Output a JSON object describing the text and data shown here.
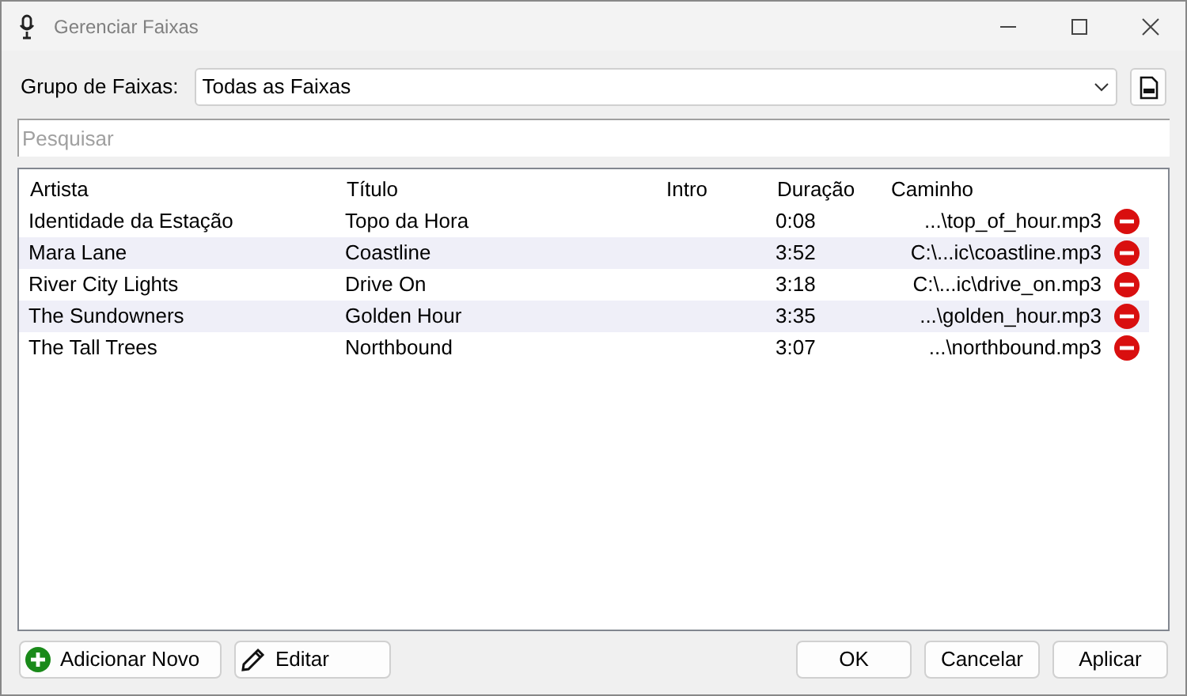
{
  "window": {
    "title": "Gerenciar Faixas"
  },
  "group": {
    "label": "Grupo de Faixas:",
    "value": "Todas as Faixas"
  },
  "search": {
    "placeholder": "Pesquisar"
  },
  "table": {
    "columns": [
      "Artista",
      "Título",
      "Intro",
      "Duração",
      "Caminho"
    ],
    "rows": [
      {
        "artist": "Identidade da Estação",
        "title": "Topo da Hora",
        "duration": "0:08",
        "path": "...\\top_of_hour.mp3"
      },
      {
        "artist": "Mara Lane",
        "title": "Coastline",
        "duration": "3:52",
        "path": "C:\\...ic\\coastline.mp3"
      },
      {
        "artist": "River City Lights",
        "title": "Drive On",
        "duration": "3:18",
        "path": "C:\\...ic\\drive_on.mp3"
      },
      {
        "artist": "The Sundowners",
        "title": "Golden Hour",
        "duration": "3:35",
        "path": "...\\golden_hour.mp3"
      },
      {
        "artist": "The Tall Trees",
        "title": "Northbound",
        "duration": "3:07",
        "path": "...\\northbound.mp3"
      }
    ]
  },
  "left_buttons": [
    {
      "kind": "add",
      "label": "Adicionar Novo"
    },
    {
      "kind": "edit",
      "label": "Editar"
    }
  ],
  "right_buttons": [
    "OK",
    "Cancelar",
    "Aplicar"
  ]
}
